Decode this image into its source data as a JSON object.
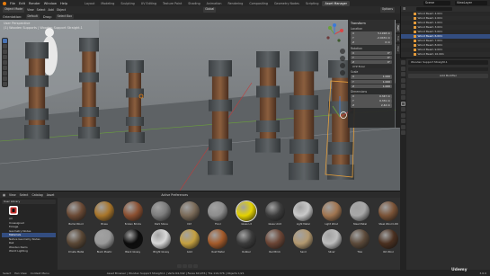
{
  "menubar": {
    "items": [
      "File",
      "Edit",
      "Render",
      "Window",
      "Help"
    ],
    "workspaces": [
      "Layout",
      "Modeling",
      "Sculpting",
      "UV Editing",
      "Texture Paint",
      "Shading",
      "Animation",
      "Rendering",
      "Compositing",
      "Geometry Nodes",
      "Scripting",
      "Asset Manager"
    ],
    "active_workspace": "Asset Manager",
    "scene": "Scene",
    "view_layer": "ViewLayer"
  },
  "viewport_header": {
    "mode": "Object Mode",
    "view": "View",
    "select": "Select",
    "add": "Add",
    "object": "Object",
    "transform_orientation": "Global",
    "orientation": "Orientation:",
    "orientation_value": "Default",
    "drag": "Drag:",
    "drag_value": "Select Box",
    "options": "Options"
  },
  "viewport": {
    "perspective_label": "User Perspective",
    "object_label": "(1) Wooden Supports | Wooden Support Straight.1"
  },
  "n_panel": {
    "title": "Transform",
    "location_label": "Location",
    "location": [
      [
        "X",
        "5.1918 m"
      ],
      [
        "Y",
        "-2.0431 m"
      ],
      [
        "Z",
        "0 m"
      ]
    ],
    "rotation_label": "Rotation",
    "rotation": [
      [
        "X",
        "0°"
      ],
      [
        "Y",
        "0°"
      ],
      [
        "Z",
        "0°"
      ]
    ],
    "rotation_mode": "XYZ Euler",
    "scale_label": "Scale",
    "scale": [
      [
        "X",
        "1.000"
      ],
      [
        "Y",
        "1.000"
      ],
      [
        "Z",
        "1.000"
      ]
    ],
    "dimensions_label": "Dimensions",
    "dimensions": [
      [
        "X",
        "0.347 m"
      ],
      [
        "Y",
        "0.331 m"
      ],
      [
        "Z",
        "2.44 m"
      ]
    ],
    "tabs": [
      "Item",
      "Tool",
      "View"
    ]
  },
  "outliner": {
    "rows": [
      "Wood Beam 4.001",
      "Wood Beam 2.001",
      "Wood Beam 1.001",
      "Wood Beam 3.001",
      "Wood Beam 5.001",
      "Wood Beam 6.001",
      "Wood Beam 7.001",
      "Wood Beam 8.001",
      "Wood Beam 9.001",
      "Wood Beam 10.001"
    ],
    "selected_index": 5
  },
  "properties": {
    "object_name": "Wooden Support Straight.1",
    "add_modifier": "Add Modifier"
  },
  "asset_browser": {
    "menus": [
      "View",
      "Select",
      "Catalog",
      "Asset"
    ],
    "library": "User Library",
    "catalog_header": "Active Preferences",
    "categories": [
      "All",
      "Unassigned",
      "Foliage",
      "Geometry Nodes",
      "Materials",
      "Native Geometry Nodes",
      "Rail",
      "Wooden Items",
      "World Lighting"
    ],
    "selected_category": "Materials",
    "assets": [
      {
        "name": "Barrel Wood",
        "color": "#6b4a35"
      },
      {
        "name": "Brass",
        "color": "#a8752a"
      },
      {
        "name": "Broken Bricks",
        "color": "#8b4f30"
      },
      {
        "name": "Dark Stone",
        "color": "#7c7c7c"
      },
      {
        "name": "Dirt",
        "color": "#7a6a58"
      },
      {
        "name": "Floor",
        "color": "#8d8d8d"
      },
      {
        "name": "Glass Lit",
        "color": "#e4d200"
      },
      {
        "name": "Glass Unlit",
        "color": "#3c3c3c"
      },
      {
        "name": "Light Metal",
        "color": "#c9c9c9"
      },
      {
        "name": "Light Wood",
        "color": "#a17550"
      },
      {
        "name": "Steel Metal",
        "color": "#a8a8a8"
      },
      {
        "name": "Steel Wood LDR",
        "color": "#7a5337"
      },
      {
        "name": "Ornate Metal",
        "color": "#5a4735"
      },
      {
        "name": "Black Plastic",
        "color": "#9a9a9a"
      },
      {
        "name": "Black Glossy",
        "color": "#0c0c0c"
      },
      {
        "name": "Bright Glossy",
        "color": "#d9d9d9"
      },
      {
        "name": "Gold",
        "color": "#c4a040"
      },
      {
        "name": "Rust Metal",
        "color": "#a35a2a"
      },
      {
        "name": "Rubber",
        "color": "#3b3b3b"
      },
      {
        "name": "Red Brick",
        "color": "#6b4535"
      },
      {
        "name": "Sand",
        "color": "#b39970"
      },
      {
        "name": "Silver",
        "color": "#bdbdbd"
      },
      {
        "name": "Tiles",
        "color": "#5c4a3a"
      },
      {
        "name": "Old Wood",
        "color": "#4a3020"
      }
    ],
    "selected_asset": "Glass Lit"
  },
  "statusbar": {
    "select": "Select",
    "pan": "Pan View",
    "context": "Context Menu",
    "info": "Asset Browser | Wooden Support Straight.1 | Verts 64,342 | Faces 60,976 | Tris 119,376 | Objects 1/21",
    "version": "3.6.0"
  },
  "watermark": "Udemy",
  "colors": {
    "accent": "#4772b3",
    "selection": "#e8a03a",
    "active_orange": "#e87d0d"
  }
}
